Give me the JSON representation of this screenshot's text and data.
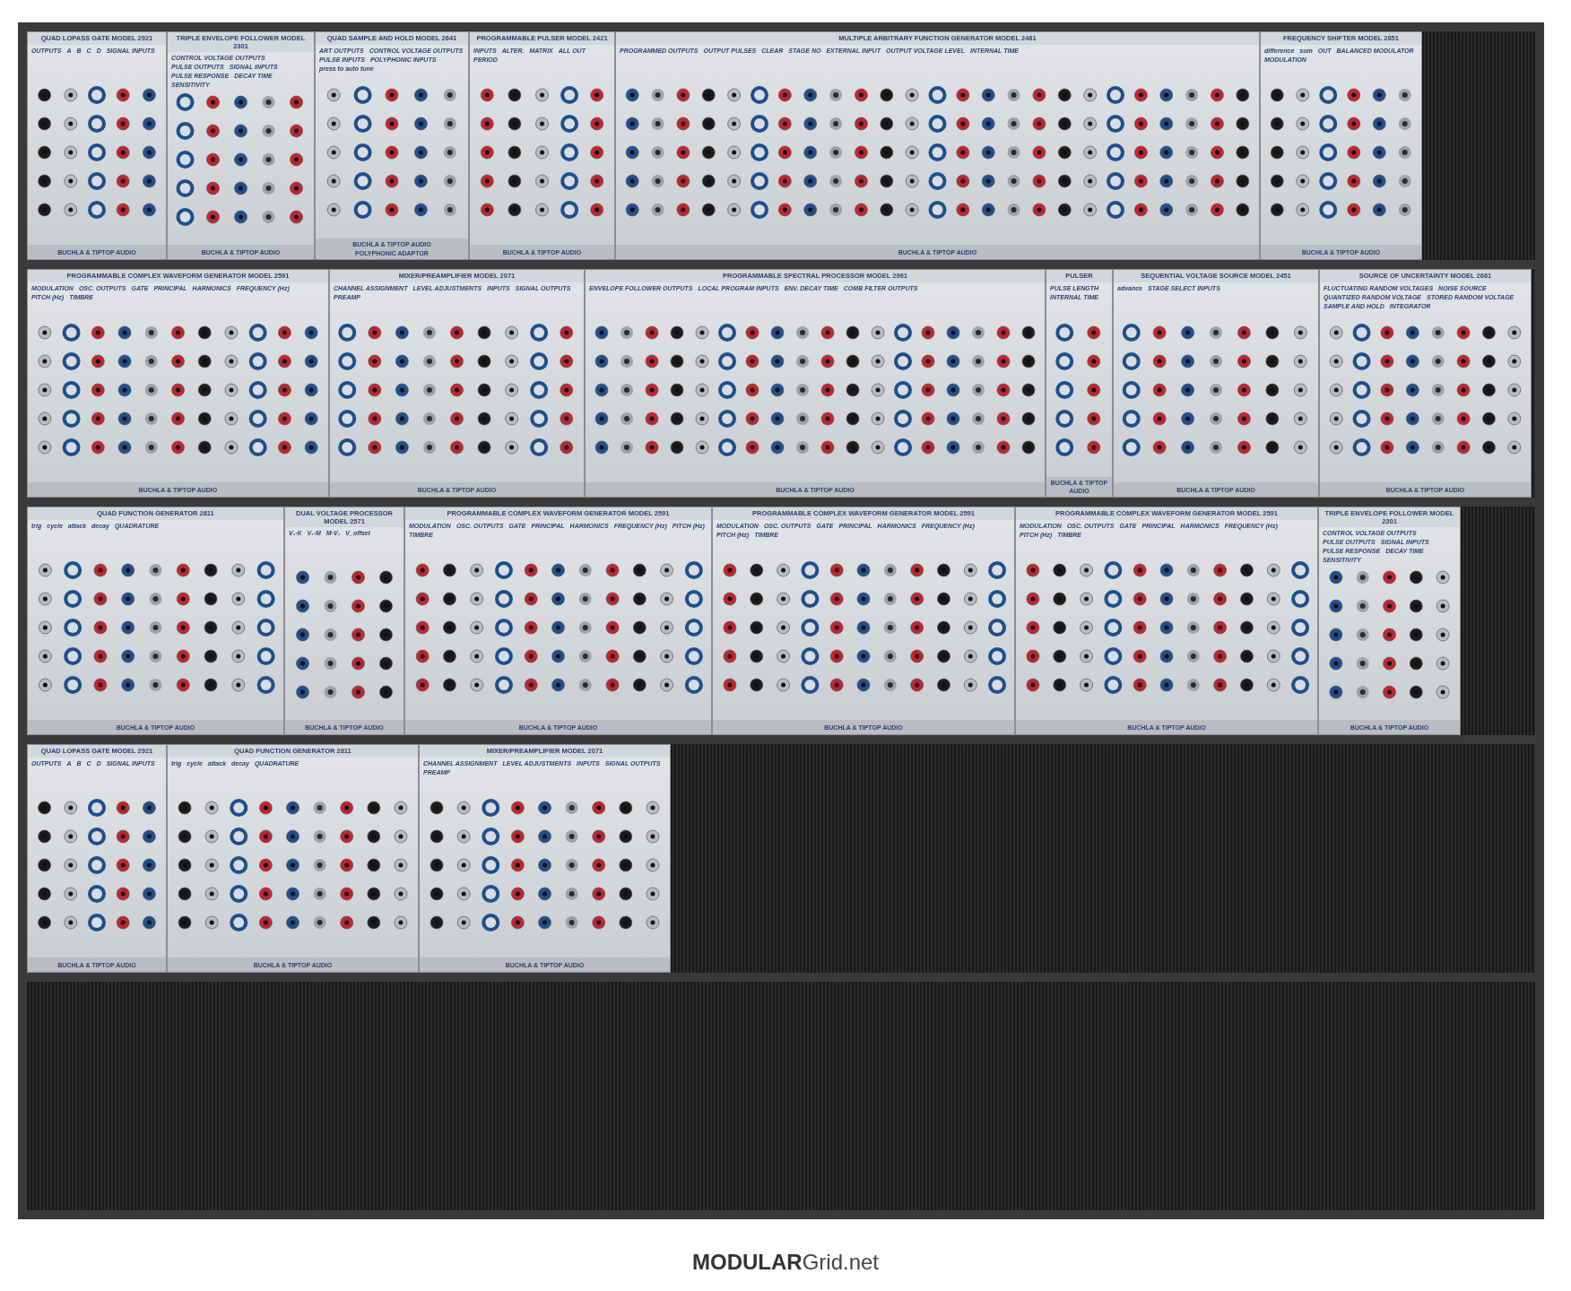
{
  "rack": {
    "rows": [
      {
        "modules": [
          {
            "title": "QUAD LOPASS GATE MODEL 2921",
            "labels": [
              "OUTPUTS",
              "A",
              "B",
              "C",
              "D",
              "SIGNAL INPUTS"
            ],
            "footers": [
              "BUCHLA & TIPTOP AUDIO"
            ]
          },
          {
            "title": "TRIPLE ENVELOPE FOLLOWER MODEL 2301",
            "labels": [
              "CONTROL VOLTAGE OUTPUTS",
              "PULSE OUTPUTS",
              "SIGNAL INPUTS",
              "PULSE RESPONSE",
              "DECAY TIME",
              "SENSITIVITY"
            ],
            "footers": [
              "BUCHLA & TIPTOP AUDIO"
            ]
          },
          {
            "title": "QUAD SAMPLE AND HOLD MODEL 2641",
            "labels": [
              "ART OUTPUTS",
              "CONTROL VOLTAGE OUTPUTS",
              "PULSE INPUTS",
              "POLYPHONIC INPUTS",
              "press to auto tune"
            ],
            "footers": [
              "BUCHLA & TIPTOP AUDIO",
              "POLYPHONIC ADAPTOR"
            ]
          },
          {
            "title": "PROGRAMMABLE PULSER MODEL 2421",
            "labels": [
              "INPUTS",
              "ALTER.",
              "MATRIX",
              "ALL OUT",
              "PERIOD"
            ],
            "footers": [
              "BUCHLA & TIPTOP AUDIO"
            ]
          },
          {
            "title": "MULTIPLE ARBITRARY FUNCTION GENERATOR MODEL 2481",
            "labels": [
              "PROGRAMMED OUTPUTS",
              "OUTPUT PULSES",
              "CLEAR",
              "STAGE NO",
              "EXTERNAL INPUT",
              "OUTPUT VOLTAGE LEVEL",
              "INTERNAL TIME"
            ],
            "footers": [
              "BUCHLA & TIPTOP AUDIO"
            ]
          },
          {
            "title": "FREQUENCY SHIFTER MODEL 2851",
            "labels": [
              "difference",
              "sum",
              "OUT",
              "BALANCED MODULATOR",
              "MODULATION"
            ],
            "footers": [
              "BUCHLA & TIPTOP AUDIO"
            ]
          }
        ]
      },
      {
        "modules": [
          {
            "title": "PROGRAMMABLE COMPLEX WAVEFORM GENERATOR MODEL 2591",
            "labels": [
              "MODULATION",
              "OSC. OUTPUTS",
              "GATE",
              "PRINCIPAL",
              "HARMONICS",
              "FREQUENCY (Hz)",
              "PITCH (Hz)",
              "TIMBRE"
            ],
            "footers": [
              "BUCHLA & TIPTOP AUDIO"
            ]
          },
          {
            "title": "MIXER/PREAMPLIFIER MODEL 2071",
            "labels": [
              "CHANNEL ASSIGNMENT",
              "LEVEL ADJUSTMENTS",
              "INPUTS",
              "SIGNAL OUTPUTS",
              "PREAMP"
            ],
            "footers": [
              "BUCHLA & TIPTOP AUDIO"
            ]
          },
          {
            "title": "PROGRAMMABLE SPECTRAL PROCESSOR MODEL 2961",
            "labels": [
              "ENVELOPE FOLLOWER OUTPUTS",
              "LOCAL PROGRAM INPUTS",
              "ENV. DECAY TIME",
              "COMB FILTER OUTPUTS"
            ],
            "footers": [
              "BUCHLA & TIPTOP AUDIO"
            ]
          },
          {
            "title": "PULSER",
            "labels": [
              "PULSE LENGTH",
              "INTERNAL TIME"
            ],
            "footers": [
              "BUCHLA & TIPTOP AUDIO"
            ]
          },
          {
            "title": "SEQUENTIAL VOLTAGE SOURCE MODEL 2451",
            "labels": [
              "advance",
              "STAGE SELECT INPUTS"
            ],
            "footers": [
              "BUCHLA & TIPTOP AUDIO"
            ]
          },
          {
            "title": "SOURCE OF UNCERTAINTY MODEL 2661",
            "labels": [
              "FLUCTUATING RANDOM VOLTAGES",
              "NOISE SOURCE",
              "QUANTIZED RANDOM VOLTAGE",
              "STORED RANDOM VOLTAGE",
              "SAMPLE AND HOLD",
              "INTEGRATOR"
            ],
            "footers": [
              "BUCHLA & TIPTOP AUDIO"
            ]
          }
        ]
      },
      {
        "modules": [
          {
            "title": "QUAD FUNCTION GENERATOR 2811",
            "labels": [
              "trig",
              "cycle",
              "attack",
              "decay",
              "QUADRATURE"
            ],
            "footers": [
              "BUCHLA & TIPTOP AUDIO"
            ]
          },
          {
            "title": "DUAL VOLTAGE PROCESSOR MODEL 2571",
            "labels": [
              "V₁·K",
              "V₁·M",
              "M·V₂",
              "V_offset"
            ],
            "footers": [
              "BUCHLA & TIPTOP AUDIO"
            ]
          },
          {
            "title": "PROGRAMMABLE COMPLEX WAVEFORM GENERATOR MODEL 2591",
            "labels": [
              "MODULATION",
              "OSC. OUTPUTS",
              "GATE",
              "PRINCIPAL",
              "HARMONICS",
              "FREQUENCY (Hz)",
              "PITCH (Hz)",
              "TIMBRE"
            ],
            "footers": [
              "BUCHLA & TIPTOP AUDIO"
            ]
          },
          {
            "title": "PROGRAMMABLE COMPLEX WAVEFORM GENERATOR MODEL 2591",
            "labels": [
              "MODULATION",
              "OSC. OUTPUTS",
              "GATE",
              "PRINCIPAL",
              "HARMONICS",
              "FREQUENCY (Hz)",
              "PITCH (Hz)",
              "TIMBRE"
            ],
            "footers": [
              "BUCHLA & TIPTOP AUDIO"
            ]
          },
          {
            "title": "PROGRAMMABLE COMPLEX WAVEFORM GENERATOR MODEL 2591",
            "labels": [
              "MODULATION",
              "OSC. OUTPUTS",
              "GATE",
              "PRINCIPAL",
              "HARMONICS",
              "FREQUENCY (Hz)",
              "PITCH (Hz)",
              "TIMBRE"
            ],
            "footers": [
              "BUCHLA & TIPTOP AUDIO"
            ]
          },
          {
            "title": "TRIPLE ENVELOPE FOLLOWER MODEL 2301",
            "labels": [
              "CONTROL VOLTAGE OUTPUTS",
              "PULSE OUTPUTS",
              "SIGNAL INPUTS",
              "PULSE RESPONSE",
              "DECAY TIME",
              "SENSITIVITY"
            ],
            "footers": [
              "BUCHLA & TIPTOP AUDIO"
            ]
          }
        ]
      },
      {
        "modules": [
          {
            "title": "QUAD LOPASS GATE MODEL 2921",
            "labels": [
              "OUTPUTS",
              "A",
              "B",
              "C",
              "D",
              "SIGNAL INPUTS"
            ],
            "footers": [
              "BUCHLA & TIPTOP AUDIO"
            ]
          },
          {
            "title": "QUAD FUNCTION GENERATOR 2811",
            "labels": [
              "trig",
              "cycle",
              "attack",
              "decay",
              "QUADRATURE"
            ],
            "footers": [
              "BUCHLA & TIPTOP AUDIO"
            ]
          },
          {
            "title": "MIXER/PREAMPLIFIER MODEL 2071",
            "labels": [
              "CHANNEL ASSIGNMENT",
              "LEVEL ADJUSTMENTS",
              "INPUTS",
              "SIGNAL OUTPUTS",
              "PREAMP"
            ],
            "footers": [
              "BUCHLA & TIPTOP AUDIO"
            ]
          }
        ]
      }
    ]
  },
  "logo": {
    "bold": "MODULAR",
    "rest": "Grid.net"
  }
}
